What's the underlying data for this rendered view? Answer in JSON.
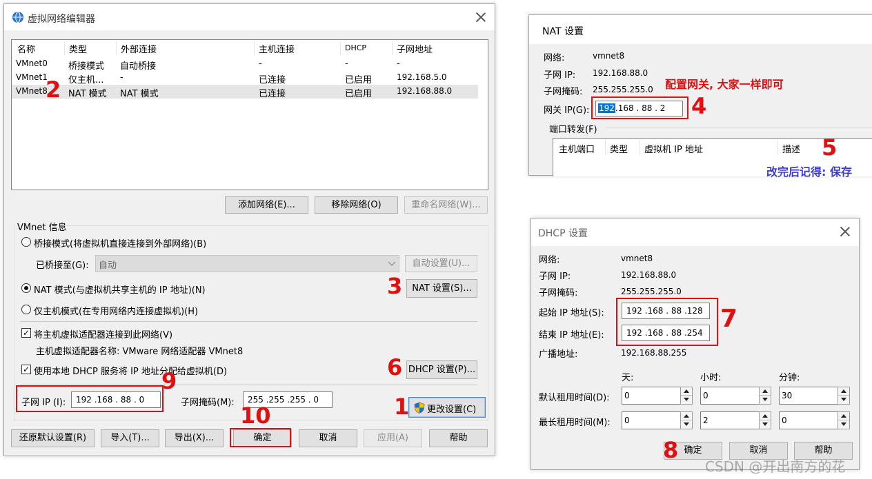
{
  "main_window": {
    "title": "虚拟网络编辑器",
    "columns": [
      "名称",
      "类型",
      "外部连接",
      "主机连接",
      "DHCP",
      "子网地址"
    ],
    "rows": [
      [
        "VMnet0",
        "桥接模式",
        "自动桥接",
        "-",
        "-",
        "-"
      ],
      [
        "VMnet1",
        "仅主机...",
        "-",
        "已连接",
        "已启用",
        "192.168.5.0"
      ],
      [
        "VMnet8",
        "NAT 模式",
        "NAT 模式",
        "已连接",
        "已启用",
        "192.168.88.0"
      ]
    ],
    "add_network_label": "添加网络(E)...",
    "remove_network_label": "移除网络(O)",
    "rename_network_label": "重命名网络(W)...",
    "vmnet_info_label": "VMnet 信息",
    "bridge_mode_label": "桥接模式(将虚拟机直接连接到外部网络)(B)",
    "bridged_to_label": "已桥接至(G):",
    "bridged_to_value": "自动",
    "auto_settings_label": "自动设置(U)...",
    "nat_mode_label": "NAT 模式(与虚拟机共享主机的 IP 地址)(N)",
    "nat_settings_label": "NAT 设置(S)...",
    "host_only_label": "仅主机模式(在专用网络内连接虚拟机)(H)",
    "connect_adapter_label": "将主机虚拟适配器连接到此网络(V)",
    "adapter_name_label": "主机虚拟适配器名称: VMware 网络适配器 VMnet8",
    "use_dhcp_label": "使用本地 DHCP 服务将 IP 地址分配给虚拟机(D)",
    "dhcp_settings_label": "DHCP 设置(P)...",
    "subnet_ip_label": "子网 IP (I):",
    "subnet_ip_value": "192 .168 . 88 .  0",
    "subnet_mask_label": "子网掩码(M):",
    "subnet_mask_value": "255 .255 .255 .  0",
    "change_settings_label": "更改设置(C)",
    "restore_defaults_label": "还原默认设置(R)",
    "import_label": "导入(T)...",
    "export_label": "导出(X)...",
    "ok_label": "确定",
    "cancel_label": "取消",
    "apply_label": "应用(A)",
    "help_label": "帮助"
  },
  "nat_window": {
    "title": "NAT 设置",
    "network_label": "网络:",
    "network_value": "vmnet8",
    "subnet_ip_label": "子网 IP:",
    "subnet_ip_value": "192.168.88.0",
    "subnet_mask_label": "子网掩码:",
    "subnet_mask_value": "255.255.255.0",
    "gateway_label": "网关 IP(G):",
    "gateway_highlight": "192",
    "gateway_rest": ".168 . 88 .  2",
    "port_forward_label": "端口转发(F)",
    "columns": [
      "主机端口",
      "类型",
      "虚拟机 IP 地址",
      "描述"
    ]
  },
  "dhcp_window": {
    "title": "DHCP 设置",
    "network_label": "网络:",
    "network_value": "vmnet8",
    "subnet_ip_label": "子网 IP:",
    "subnet_ip_value": "192.168.88.0",
    "subnet_mask_label": "子网掩码:",
    "subnet_mask_value": "255.255.255.0",
    "start_ip_label": "起始 IP 地址(S):",
    "start_ip_value": "192 .168 . 88 .128",
    "end_ip_label": "结束 IP 地址(E):",
    "end_ip_value": "192 .168 . 88 .254",
    "broadcast_label": "广播地址:",
    "broadcast_value": "192.168.88.255",
    "days_label": "天:",
    "hours_label": "小时:",
    "minutes_label": "分钟:",
    "default_lease_label": "默认租用时间(D):",
    "default_lease": [
      "0",
      "0",
      "30"
    ],
    "max_lease_label": "最长租用时间(M):",
    "max_lease": [
      "0",
      "2",
      "0"
    ],
    "ok_label": "确定",
    "cancel_label": "取消",
    "help_label": "帮助"
  },
  "annotations": {
    "n1": "1",
    "n2": "2",
    "n3": "3",
    "n4": "4",
    "n5": "5",
    "n6": "6",
    "n7": "7",
    "n8": "8",
    "n9": "9",
    "n10": "10",
    "gateway_note": "配置网关, 大家一样即可",
    "save_note": "改完后记得: 保存"
  },
  "watermark": "CSDN @开出南方的花",
  "colors": {
    "annotation_red": "#e01010",
    "note_blue": "#3a3acc",
    "selection_blue": "#0078d7"
  }
}
